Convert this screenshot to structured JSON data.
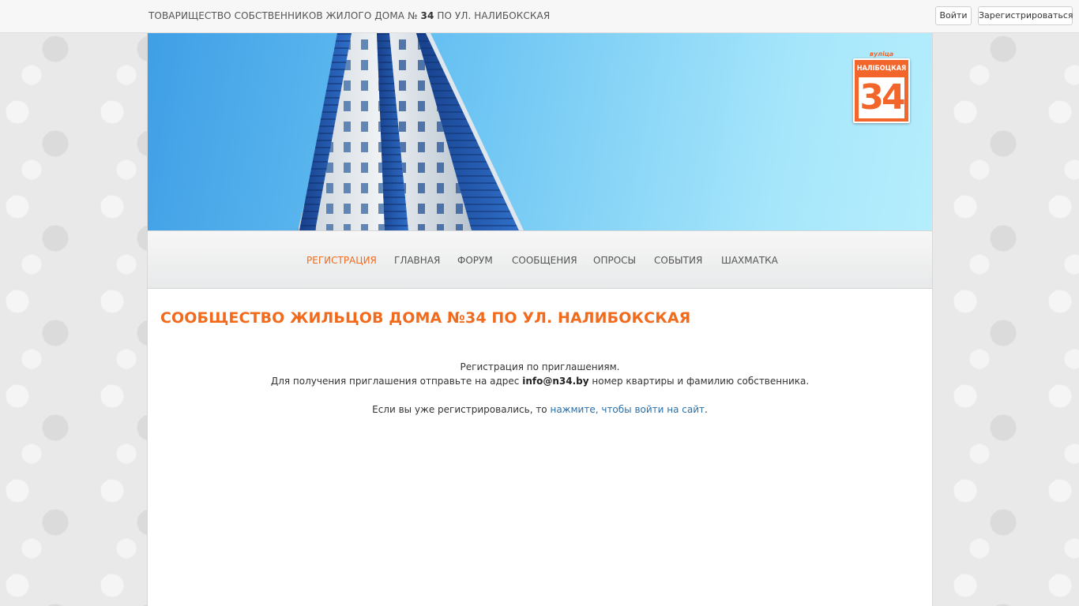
{
  "topbar": {
    "title_prefix": "ТОВАРИЩЕСТВО СОБСТВЕННИКОВ ЖИЛОГО ДОМА №",
    "title_number": "34",
    "title_suffix": "ПО УЛ. НАЛИБОКСКАЯ",
    "login_label": "Войти",
    "register_label": "Зарегистрироваться"
  },
  "banner": {
    "logo_arc": "вуліца",
    "logo_street": "НАЛІБОЦКАЯ",
    "logo_number": "34",
    "colors": {
      "logo": "#f2662b",
      "sky": "#7fd3f7"
    }
  },
  "nav": {
    "items": [
      {
        "label": "РЕГИСТРАЦИЯ",
        "active": true
      },
      {
        "label": "ГЛАВНАЯ"
      },
      {
        "label": "ФОРУМ"
      },
      {
        "label": "СООБЩЕНИЯ"
      },
      {
        "label": "ОПРОСЫ"
      },
      {
        "label": "СОБЫТИЯ"
      },
      {
        "label": "ШАХМАТКА"
      }
    ],
    "colors": {
      "active": "#f26b1d",
      "default": "#555555"
    }
  },
  "content": {
    "heading": "СООБЩЕСТВО ЖИЛЬЦОВ ДОМА №34 ПО УЛ. НАЛИБОКСКАЯ",
    "line1": "Регистрация по приглашениям.",
    "line2_prefix": "Для получения приглашения отправьте на адрес",
    "email": "info@n34.by",
    "line2_suffix": "номер квартиры и фамилию собственника.",
    "line3_prefix": "Если вы уже регистрировались, то",
    "login_link": "нажмите, чтобы войти на сайт",
    "line3_suffix": "."
  }
}
